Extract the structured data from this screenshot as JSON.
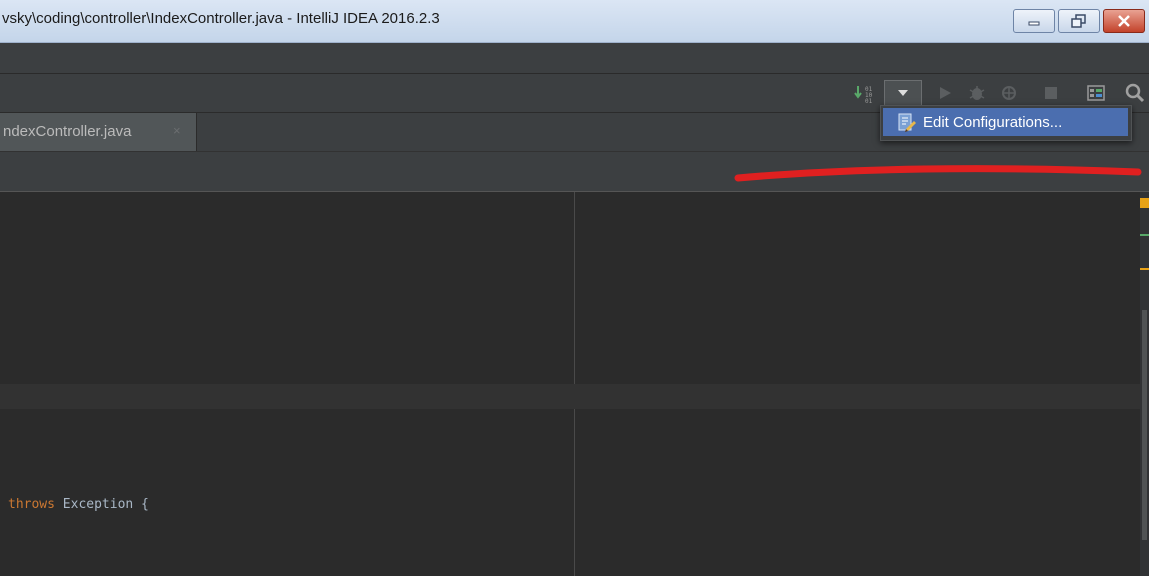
{
  "window": {
    "title": "vsky\\coding\\controller\\IndexController.java - IntelliJ IDEA 2016.2.3"
  },
  "tabs": [
    {
      "label": "ndexController.java",
      "close_glyph": "×"
    }
  ],
  "toolbar": {
    "icons": [
      "binary-data-icon",
      "chevron-down-icon",
      "run-icon",
      "debug-icon",
      "coverage-icon",
      "stop-icon",
      "project-structure-icon",
      "search-icon"
    ]
  },
  "dropdown": {
    "items": [
      {
        "label": "Edit Configurations..."
      }
    ]
  },
  "editor": {
    "lines": [
      {
        "keyword": "throws",
        "rest": " Exception {"
      },
      {
        "text": ""
      }
    ]
  },
  "colors": {
    "ide_bg": "#2b2b2b",
    "panel_bg": "#3c3f41",
    "selection": "#4b6eaf",
    "keyword": "#cc7832",
    "annotation_red": "#e02020"
  }
}
